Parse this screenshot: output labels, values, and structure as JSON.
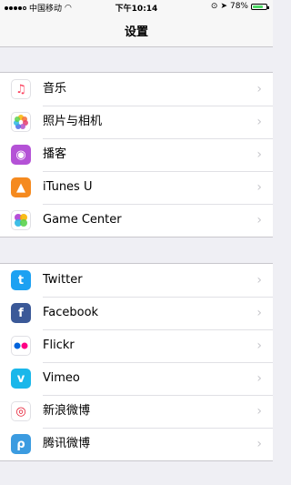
{
  "status": {
    "carrier": "中国移动",
    "time": "下午10:14",
    "battery_percent": "78%"
  },
  "nav": {
    "title": "设置"
  },
  "groups": [
    {
      "items": [
        {
          "label": "音乐",
          "icon": "music-icon",
          "color": "#fff"
        },
        {
          "label": "照片与相机",
          "icon": "photos-icon",
          "color": "#fff"
        },
        {
          "label": "播客",
          "icon": "podcasts-icon",
          "color": "#b452d6"
        },
        {
          "label": "iTunes U",
          "icon": "itunes-u-icon",
          "color": "#f58a1f"
        },
        {
          "label": "Game Center",
          "icon": "game-center-icon",
          "color": "#fff"
        }
      ]
    },
    {
      "items": [
        {
          "label": "Twitter",
          "icon": "twitter-icon",
          "color": "#1da1f2"
        },
        {
          "label": "Facebook",
          "icon": "facebook-icon",
          "color": "#3b5998"
        },
        {
          "label": "Flickr",
          "icon": "flickr-icon",
          "color": "#fff"
        },
        {
          "label": "Vimeo",
          "icon": "vimeo-icon",
          "color": "#1ab7ea"
        },
        {
          "label": "新浪微博",
          "icon": "weibo-icon",
          "color": "#fff"
        },
        {
          "label": "腾讯微博",
          "icon": "tencent-weibo-icon",
          "color": "#3b9be0"
        }
      ]
    }
  ]
}
